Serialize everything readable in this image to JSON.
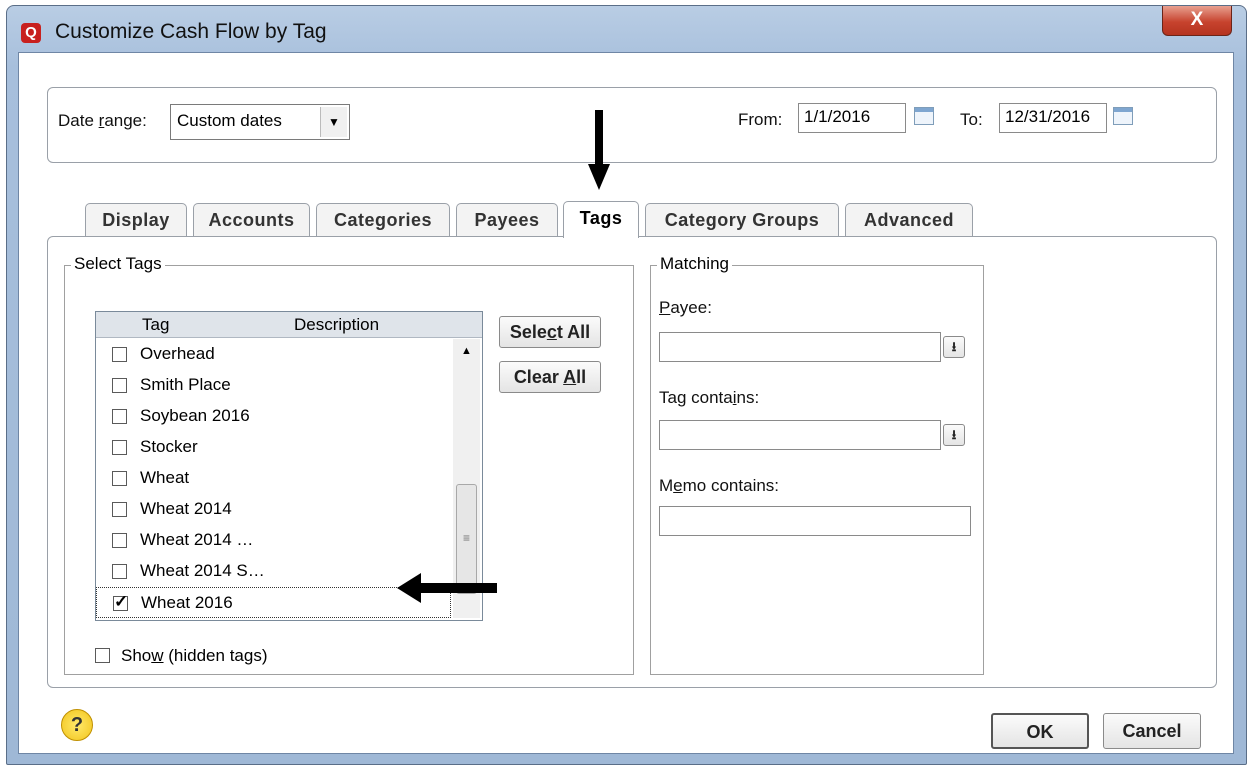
{
  "window": {
    "title": "Customize Cash Flow by Tag",
    "app_icon": "Q",
    "close_label": "X"
  },
  "date_range": {
    "label_pre": "Date ",
    "label_u": "r",
    "label_post": "ange:",
    "value": "Custom dates",
    "from_label": "From:",
    "from_value": "1/1/2016",
    "to_label": "To:",
    "to_value": "12/31/2016"
  },
  "tabs": [
    "Display",
    "Accounts",
    "Categories",
    "Payees",
    "Tags",
    "Category Groups",
    "Advanced"
  ],
  "active_tab": "Tags",
  "select_tags": {
    "group_label": "Select Tags",
    "columns": [
      "Tag",
      "Description"
    ],
    "items": [
      {
        "label": "Overhead",
        "checked": false
      },
      {
        "label": "Smith Place",
        "checked": false
      },
      {
        "label": "Soybean 2016",
        "checked": false
      },
      {
        "label": "Stocker",
        "checked": false
      },
      {
        "label": "Wheat",
        "checked": false
      },
      {
        "label": "Wheat 2014",
        "checked": false
      },
      {
        "label": "Wheat 2014 …",
        "checked": false
      },
      {
        "label": "Wheat 2014 S…",
        "checked": false
      },
      {
        "label": "Wheat 2016",
        "checked": true
      }
    ],
    "select_all": {
      "pre": "Sele",
      "u": "c",
      "post": "t All"
    },
    "clear_all": {
      "pre": "Clear ",
      "u": "A",
      "post": "ll"
    },
    "show_hidden": {
      "pre": "Sho",
      "u": "w",
      "post": " (hidden tags)",
      "checked": false
    }
  },
  "matching": {
    "group_label": "Matching",
    "payee": {
      "u": "P",
      "post": "ayee:",
      "value": ""
    },
    "tag_contains": {
      "pre": "Tag conta",
      "u": "i",
      "post": "ns:",
      "value": ""
    },
    "memo_contains": {
      "pre": "M",
      "u": "e",
      "post": "mo contains:",
      "value": ""
    }
  },
  "footer": {
    "help": "?",
    "ok": "OK",
    "cancel": "Cancel"
  }
}
